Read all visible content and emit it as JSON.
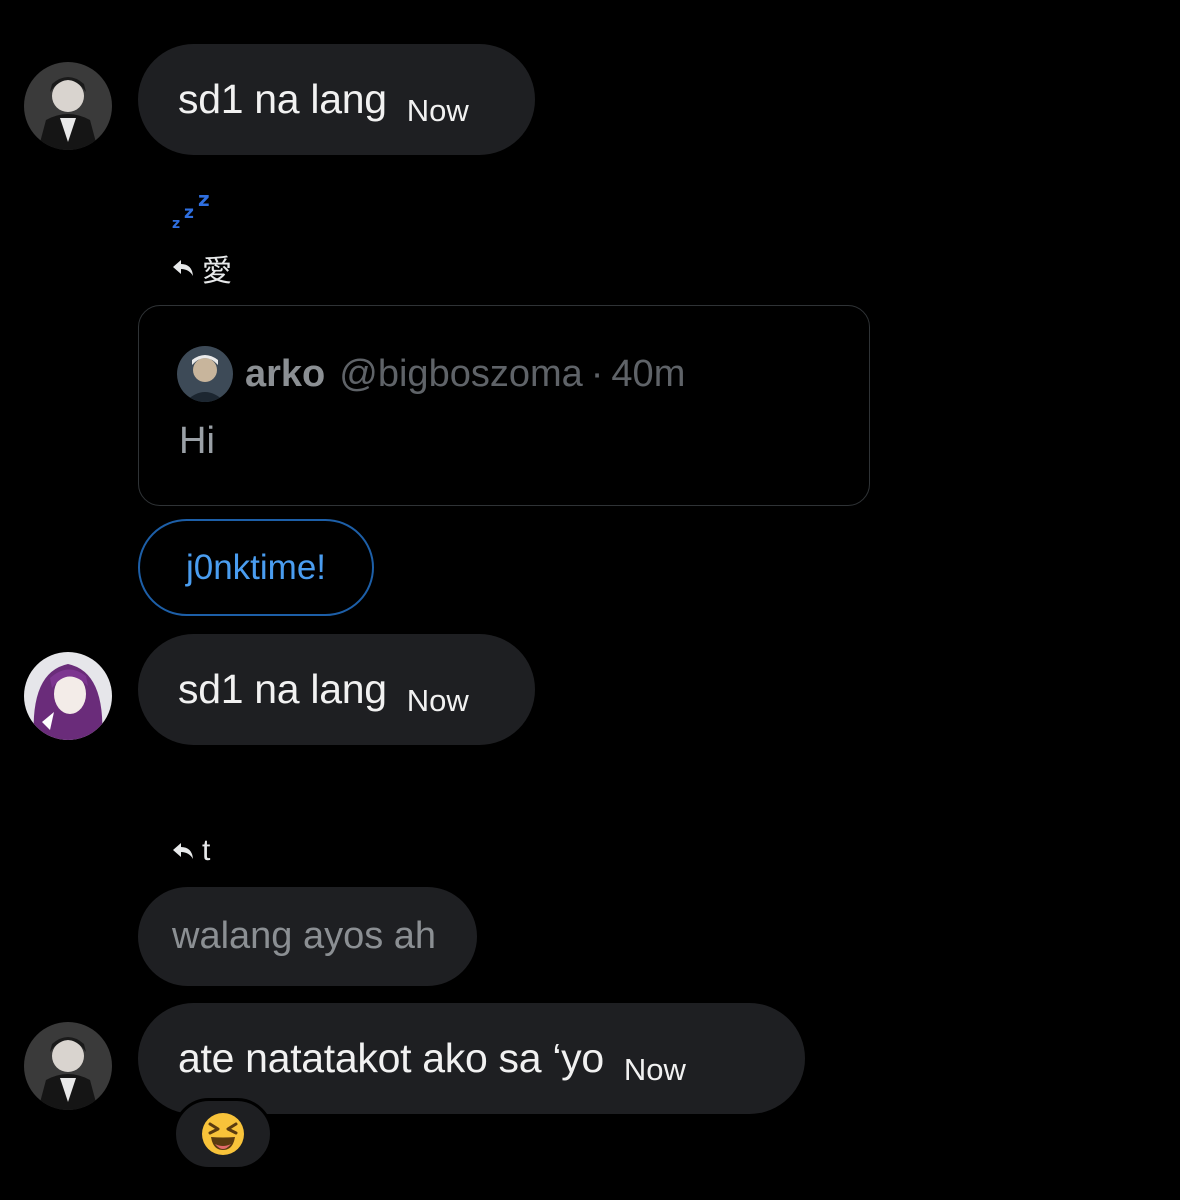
{
  "messages": [
    {
      "text": "sd1 na lang",
      "time": "Now",
      "avatar": "man-in-suit-avatar"
    },
    {
      "text": "sd1 na lang",
      "time": "Now",
      "avatar": "purple-hair-avatar"
    },
    {
      "text": "ate natatakot ako sa ‘yo",
      "time": "Now",
      "avatar": "man-in-suit-avatar"
    }
  ],
  "sleep_emoji": "zzz",
  "replies": [
    {
      "to": "愛"
    },
    {
      "to": "t"
    }
  ],
  "quote": {
    "name": "arko",
    "handle": "@bigboszoma",
    "separator": "·",
    "time": "40m",
    "body": "Hi"
  },
  "quick_reply": "j0nktime!",
  "reply_bubble": "walang ayos ah",
  "reaction": {
    "emoji": "laughing-squint-face",
    "color": "#f8c33a"
  },
  "colors": {
    "bubble": "#1e1f22",
    "accent": "#4a9df0",
    "chip_border": "#1d5fa8",
    "background": "#000000"
  }
}
